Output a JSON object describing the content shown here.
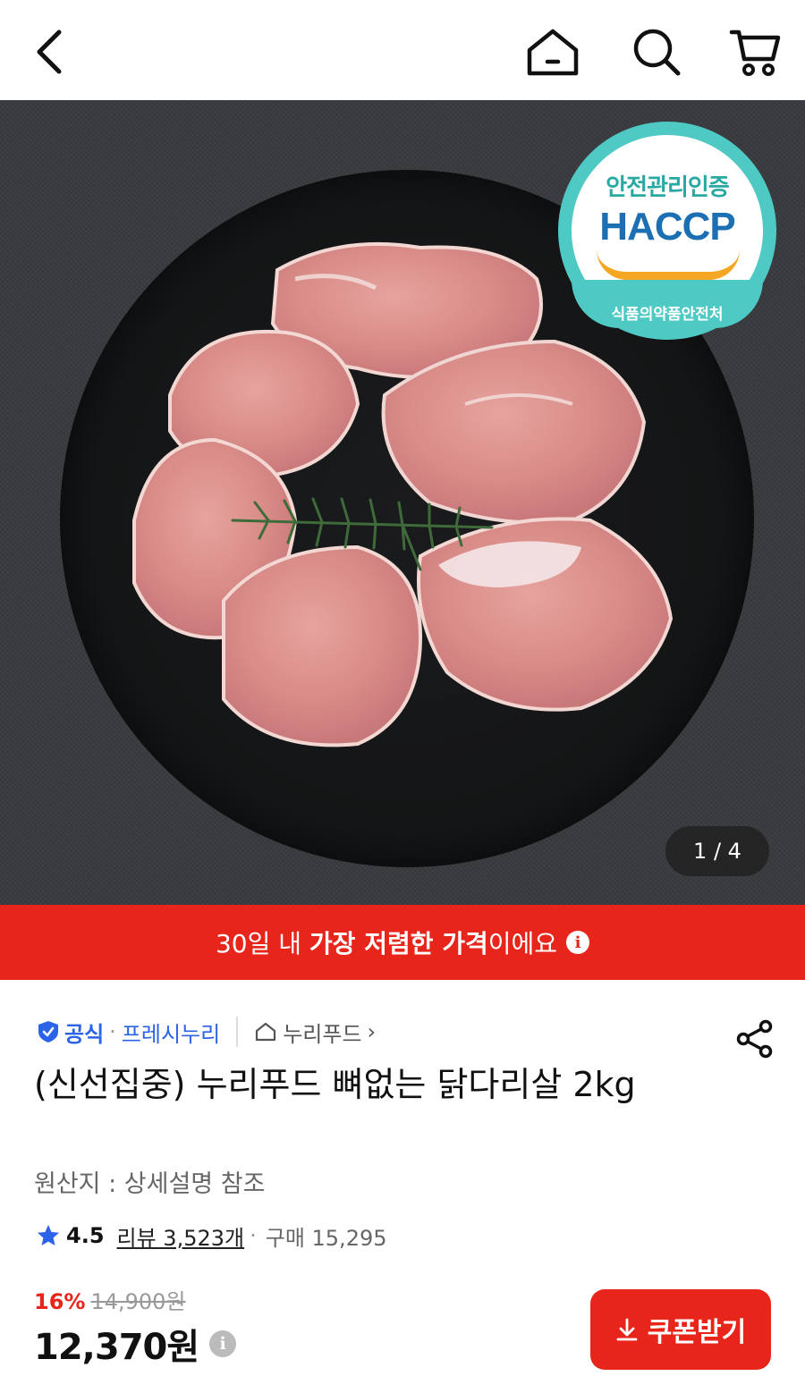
{
  "header": {
    "icons": [
      "back-arrow-icon",
      "home-icon",
      "search-icon",
      "cart-icon"
    ]
  },
  "hero": {
    "badge": {
      "top": "안전관리인증",
      "main": "HACCP",
      "bottom": "식품의약품안전처"
    },
    "page_indicator": "1 / 4"
  },
  "promo": {
    "prefix": "30일 내 ",
    "highlight": "가장 저렴한 가격",
    "suffix": "이에요",
    "info_icon": "i"
  },
  "product": {
    "official_label": "공식",
    "separator": "·",
    "seller": "프레시누리",
    "brand": "누리푸드",
    "brand_chevron": "›",
    "title": "(신선집중) 누리푸드 뼈없는 닭다리살 2kg",
    "origin": "원산지 : 상세설명 참조",
    "rating": "4.5",
    "review_label": "리뷰 3,523개",
    "buy_label": "구매 15,295",
    "discount_rate": "16%",
    "original_price": "14,900원",
    "price": "12,370원",
    "price_info_icon": "i",
    "coupon_label": "쿠폰받기"
  },
  "colors": {
    "accent_red": "#e8251b",
    "official_blue": "#2a63e8",
    "haccp_teal": "#4fc9c4"
  }
}
